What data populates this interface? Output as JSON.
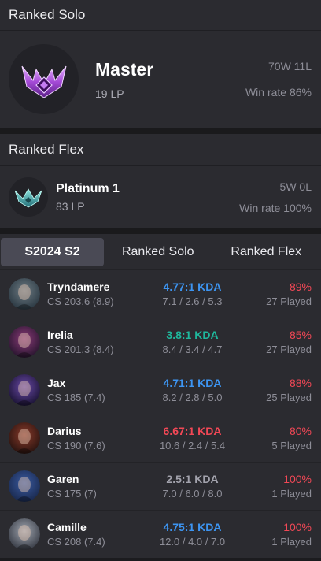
{
  "ranked_solo": {
    "title": "Ranked Solo",
    "tier": "Master",
    "lp": "19 LP",
    "record": "70W 11L",
    "win_rate": "Win rate 86%",
    "emblem_icon": "master-emblem-icon"
  },
  "ranked_flex": {
    "title": "Ranked Flex",
    "tier": "Platinum 1",
    "lp": "83 LP",
    "record": "5W 0L",
    "win_rate": "Win rate 100%",
    "emblem_icon": "platinum-emblem-icon"
  },
  "tabs": [
    {
      "label": "S2024 S2",
      "active": true
    },
    {
      "label": "Ranked Solo",
      "active": false
    },
    {
      "label": "Ranked Flex",
      "active": false
    }
  ],
  "colors": {
    "kda_blue": "#3d95f2",
    "kda_green": "#1fb79c",
    "kda_red": "#f24856",
    "kda_gray": "#a3a3ad",
    "winrate_red": "#f24856"
  },
  "champions": [
    {
      "name": "Tryndamere",
      "cs": "CS 203.6 (8.9)",
      "kda": "4.77:1 KDA",
      "kda_color": "#3d95f2",
      "kda_detail": "7.1 / 2.6 / 5.3",
      "winrate": "89%",
      "played": "27 Played"
    },
    {
      "name": "Irelia",
      "cs": "CS 201.3 (8.4)",
      "kda": "3.8:1 KDA",
      "kda_color": "#1fb79c",
      "kda_detail": "8.4 / 3.4 / 4.7",
      "winrate": "85%",
      "played": "27 Played"
    },
    {
      "name": "Jax",
      "cs": "CS 185 (7.4)",
      "kda": "4.71:1 KDA",
      "kda_color": "#3d95f2",
      "kda_detail": "8.2 / 2.8 / 5.0",
      "winrate": "88%",
      "played": "25 Played"
    },
    {
      "name": "Darius",
      "cs": "CS 190 (7.6)",
      "kda": "6.67:1 KDA",
      "kda_color": "#f24856",
      "kda_detail": "10.6 / 2.4 / 5.4",
      "winrate": "80%",
      "played": "5 Played"
    },
    {
      "name": "Garen",
      "cs": "CS 175 (7)",
      "kda": "2.5:1 KDA",
      "kda_color": "#a3a3ad",
      "kda_detail": "7.0 / 6.0 / 8.0",
      "winrate": "100%",
      "played": "1 Played"
    },
    {
      "name": "Camille",
      "cs": "CS 208 (7.4)",
      "kda": "4.75:1 KDA",
      "kda_color": "#3d95f2",
      "kda_detail": "12.0 / 4.0 / 7.0",
      "winrate": "100%",
      "played": "1 Played"
    }
  ]
}
